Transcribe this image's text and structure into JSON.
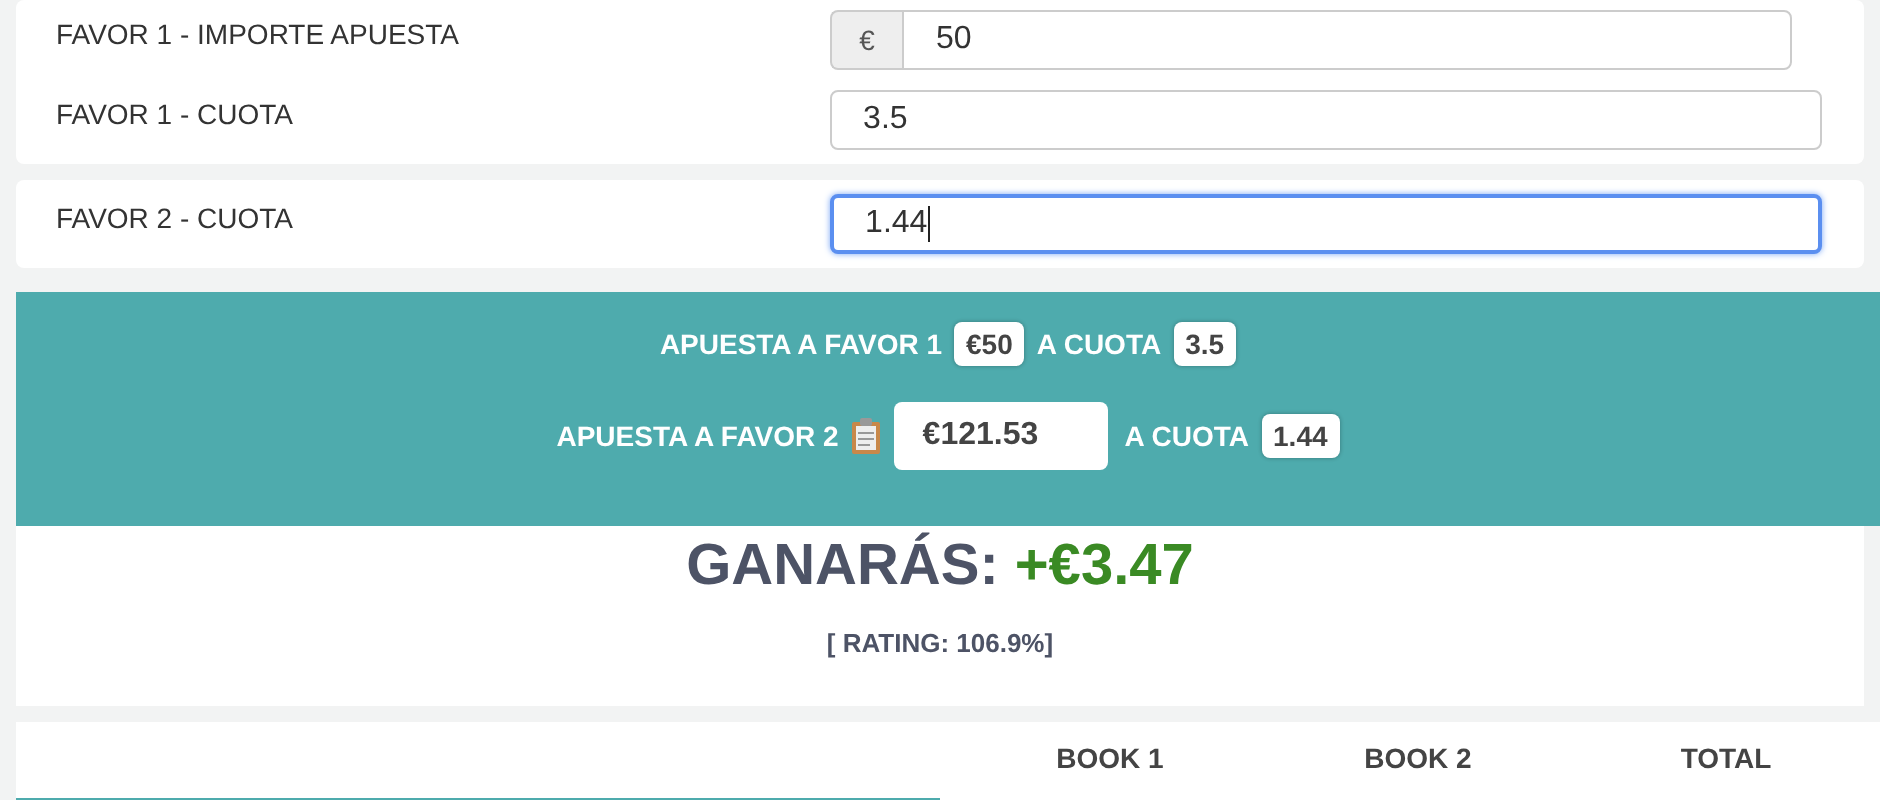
{
  "inputs_card": {
    "rows": [
      {
        "label": "FAVOR 1 - IMPORTE APUESTA",
        "prefix": "€",
        "value": "50",
        "focused": false
      },
      {
        "label": "FAVOR 1 - CUOTA",
        "value": "3.5",
        "focused": false
      }
    ]
  },
  "odds_card": {
    "rows": [
      {
        "label": "FAVOR 2 - CUOTA",
        "value": "1.44",
        "focused": true
      }
    ]
  },
  "summary": {
    "lines": [
      {
        "label": "APUESTA A FAVOR 1",
        "stake": "€50",
        "kind": "badge",
        "odds_label": "A CUOTA",
        "odds": "3.5"
      },
      {
        "label": "APUESTA A FAVOR 2",
        "stake": "€121.53",
        "kind": "field",
        "odds_label": "A CUOTA",
        "odds": "1.44"
      }
    ]
  },
  "result": {
    "label": "GANARÁS:",
    "amount": "+€3.47",
    "rating": "[ RATING: 106.9%]"
  },
  "table": {
    "columns": [
      "BOOK 1",
      "BOOK 2",
      "TOTAL"
    ]
  }
}
